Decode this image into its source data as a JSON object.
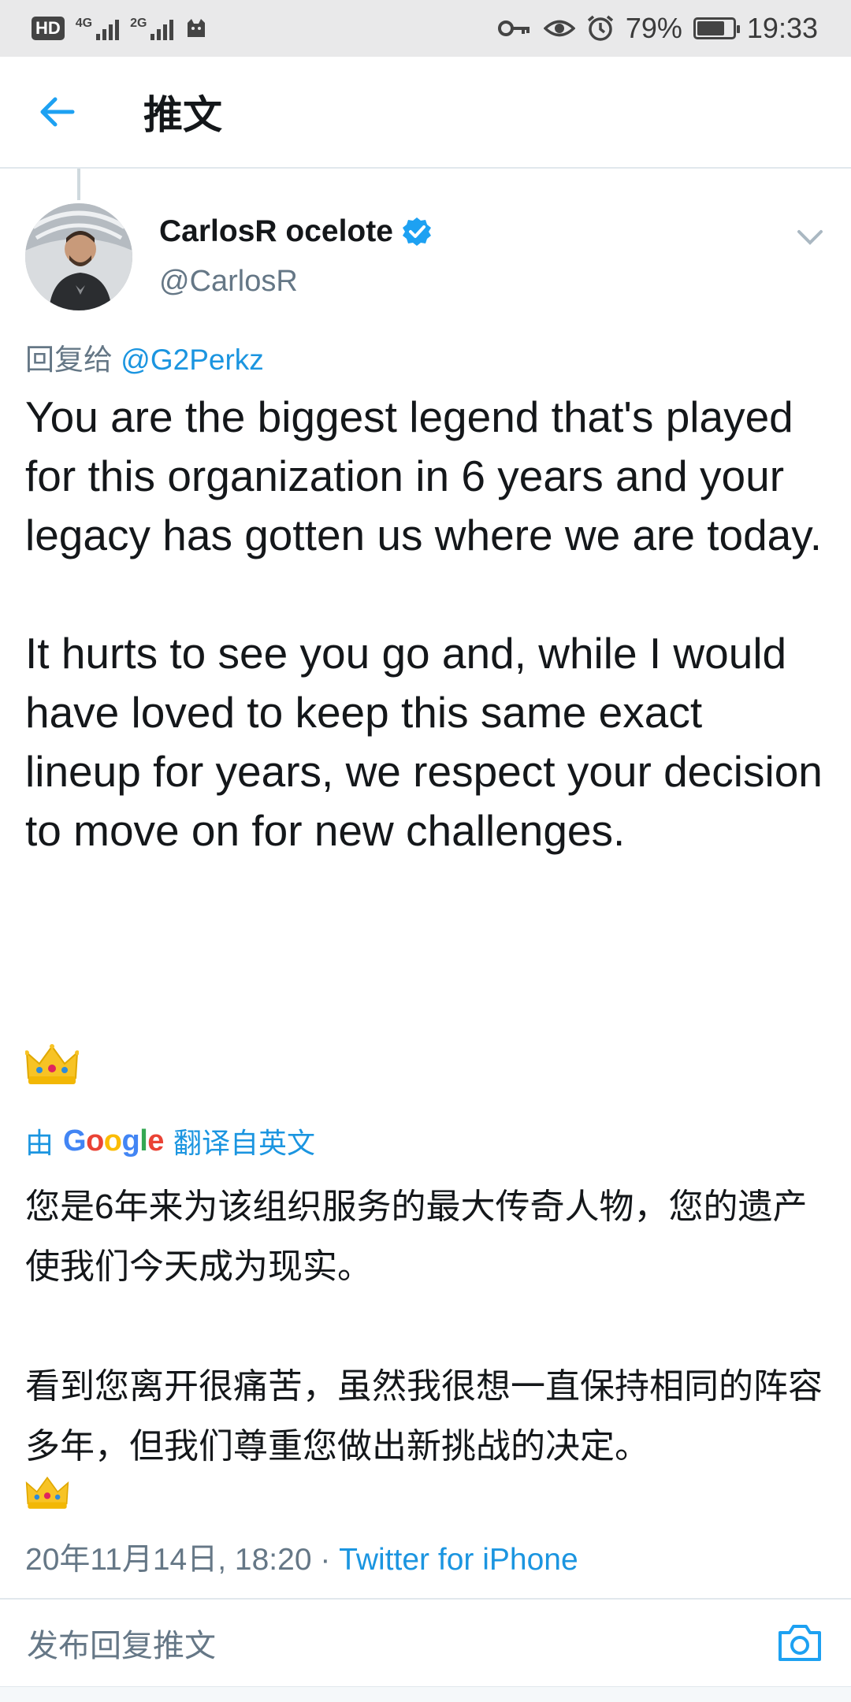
{
  "status_bar": {
    "hd_label": "HD",
    "sim1_tag": "4G",
    "sim2_tag": "2G",
    "battery_percent": "79%",
    "battery_level": 0.79,
    "time": "19:33"
  },
  "header": {
    "title": "推文",
    "back_icon": "arrow-left-icon",
    "accent": "#1da1f2"
  },
  "tweet": {
    "author_name": "CarlosR ocelote",
    "author_handle": "@CarlosR",
    "reply_prefix": "回复给 ",
    "reply_mention": "@G2Perkz",
    "text": "You are the biggest legend that's played for this organization in 6 years and your legacy has gotten us where we are today.\n\nIt hurts to see you go and, while I would have loved to keep this same exact lineup for years, we respect your decision to move on for new challenges.",
    "emoji": "👑",
    "translation_prefix": "由",
    "translation_provider": "Google",
    "translation_suffix": "翻译自英文",
    "translation_text": "您是6年来为该组织服务的最大传奇人物，您的遗产使我们今天成为现实。\n\n看到您离开很痛苦，虽然我很想一直保持相同的阵容多年，但我们尊重您做出新挑战的决定。",
    "timestamp": "20年11月14日, 18:20 · ",
    "source": "Twitter for iPhone"
  },
  "reply_bar": {
    "placeholder": "发布回复推文",
    "camera_icon": "camera-icon"
  },
  "colors": {
    "link": "#1b95e0",
    "secondary_text": "#657786",
    "primary_text": "#14171a",
    "verified": "#1da1f2"
  }
}
